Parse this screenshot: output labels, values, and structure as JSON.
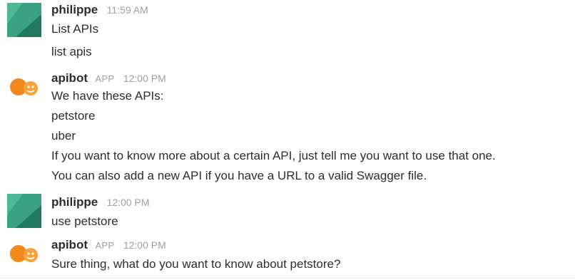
{
  "messages": [
    {
      "author": "philippe",
      "app_badge": "",
      "time": "11:59 AM",
      "avatar": "philippe-avatar-icon",
      "lines": [
        "List APIs"
      ]
    },
    {
      "author": "",
      "app_badge": "",
      "time": "",
      "lines": [
        "list apis"
      ]
    },
    {
      "author": "apibot",
      "app_badge": "APP",
      "time": "12:00 PM",
      "avatar": "apibot-avatar-icon",
      "lines": [
        "We have these APIs:",
        "petstore",
        "uber",
        "If you want to know more about a certain API, just tell me you want to use that one.",
        "You can also add a new API if you have a URL to a valid Swagger file."
      ]
    },
    {
      "author": "philippe",
      "app_badge": "",
      "time": "12:00 PM",
      "avatar": "philippe-avatar-icon",
      "lines": [
        "use petstore"
      ]
    },
    {
      "author": "apibot",
      "app_badge": "APP",
      "time": "12:00 PM",
      "avatar": "apibot-avatar-icon",
      "lines": [
        "Sure thing, what do you want to know about petstore?"
      ]
    }
  ],
  "colors": {
    "philippe_avatar_dark": "#2a8a6f",
    "philippe_avatar_light": "#5fc3a4",
    "apibot_avatar": "#f2891e"
  }
}
